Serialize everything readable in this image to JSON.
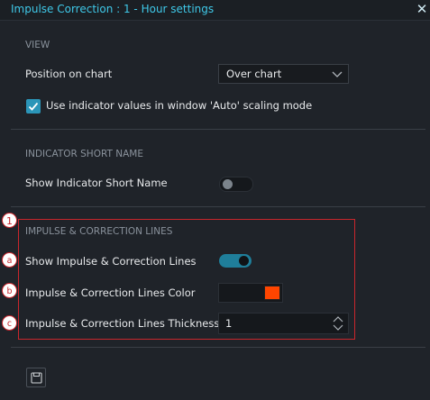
{
  "dialog": {
    "title": "Impulse Correction : 1 - Hour settings",
    "close_icon": "close-icon"
  },
  "view": {
    "section_title": "VIEW",
    "position_label": "Position on chart",
    "position_value": "Over chart",
    "auto_scaling_label": "Use indicator values in window 'Auto' scaling mode",
    "auto_scaling_checked": true
  },
  "indicator_short_name": {
    "section_title": "INDICATOR SHORT NAME",
    "show_label": "Show Indicator Short Name",
    "show_enabled": false
  },
  "impulse_lines": {
    "section_title": "IMPULSE & CORRECTION LINES",
    "show_label": "Show Impulse & Correction Lines",
    "show_enabled": true,
    "color_label": "Impulse & Correction Lines Color",
    "color_value": "#ff4500",
    "thickness_label": "Impulse & Correction Lines Thickness",
    "thickness_value": "1"
  },
  "annotations": {
    "section_marker": "1",
    "marker_a": "a",
    "marker_b": "b",
    "marker_c": "c"
  },
  "footer": {
    "save_icon": "save-icon"
  },
  "colors": {
    "accent": "#3fc8e8",
    "toggle_on": "#1f7e9a",
    "annotation_red": "#c9262c"
  }
}
